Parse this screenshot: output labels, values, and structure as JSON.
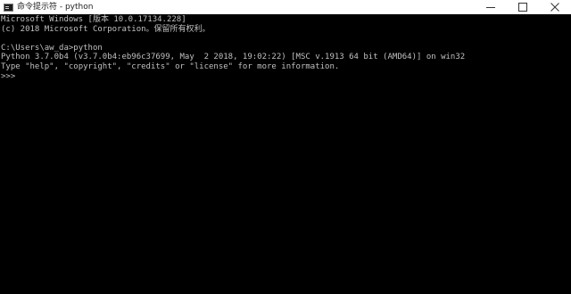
{
  "window": {
    "title": "命令提示符 - python",
    "icon": "cmd-icon",
    "controls": [
      "minimize-icon",
      "maximize-icon",
      "close-icon"
    ]
  },
  "console": {
    "background": "#000000",
    "foreground": "#c0c0c0",
    "lines": [
      "Microsoft Windows [版本 10.0.17134.228]",
      "(c) 2018 Microsoft Corporation。保留所有权利。",
      "",
      "C:\\Users\\aw_da>python",
      "Python 3.7.0b4 (v3.7.0b4:eb96c37699, May  2 2018, 19:02:22) [MSC v.1913 64 bit (AMD64)] on win32",
      "Type \"help\", \"copyright\", \"credits\" or \"license\" for more information.",
      ">>>"
    ]
  }
}
